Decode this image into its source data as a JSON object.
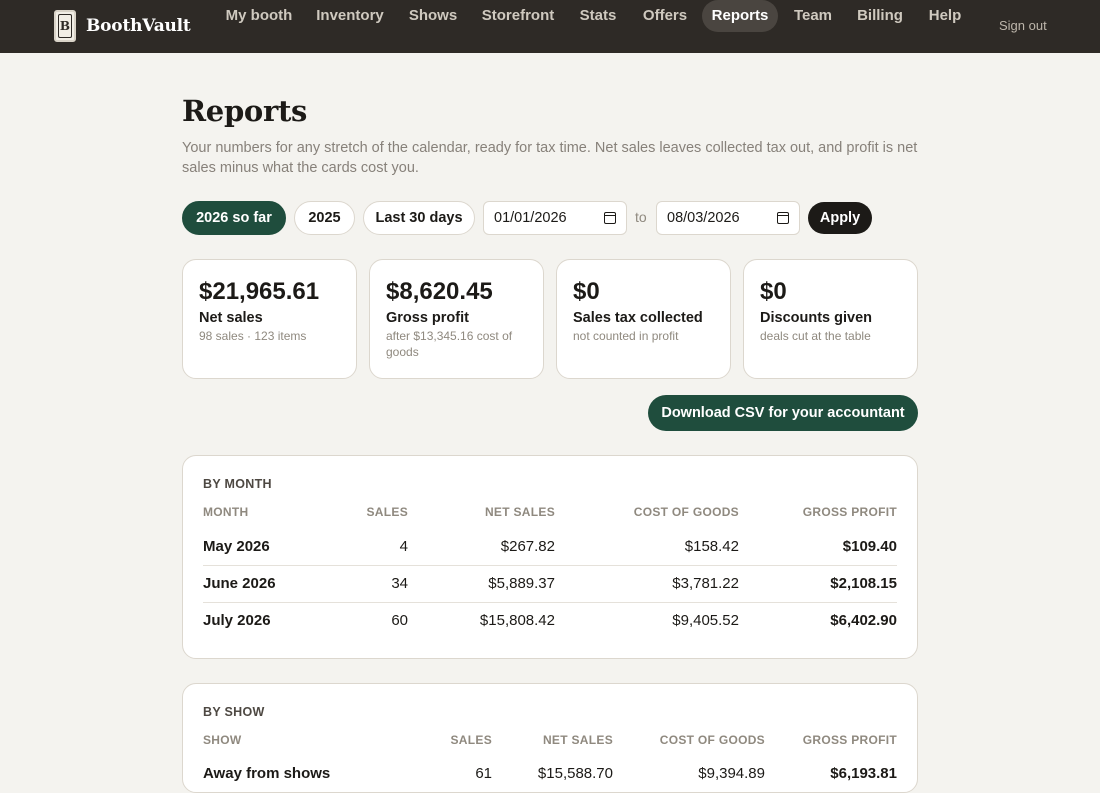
{
  "app": {
    "name": "BoothVault",
    "logo_letter": "B"
  },
  "nav": {
    "items": [
      {
        "label": "My booth",
        "active": false
      },
      {
        "label": "Inventory",
        "active": false
      },
      {
        "label": "Shows",
        "active": false
      },
      {
        "label": "Storefront",
        "active": false
      },
      {
        "label": "Stats",
        "active": false
      },
      {
        "label": "Offers",
        "active": false
      },
      {
        "label": "Reports",
        "active": true
      },
      {
        "label": "Team",
        "active": false
      },
      {
        "label": "Billing",
        "active": false
      },
      {
        "label": "Help",
        "active": false
      }
    ],
    "sign_out": "Sign out"
  },
  "header": {
    "title": "Reports",
    "description": "Your numbers for any stretch of the calendar, ready for tax time. Net sales leaves collected tax out, and profit is net sales minus what the cards cost you."
  },
  "range": {
    "presets": [
      {
        "label": "2026 so far",
        "active": true
      },
      {
        "label": "2025",
        "active": false
      },
      {
        "label": "Last 30 days",
        "active": false
      }
    ],
    "from": "01/01/2026",
    "to_label": "to",
    "to": "08/03/2026",
    "apply_label": "Apply"
  },
  "stats": [
    {
      "value": "$21,965.61",
      "label": "Net sales",
      "sub": "98 sales · 123 items"
    },
    {
      "value": "$8,620.45",
      "label": "Gross profit",
      "sub": "after $13,345.16 cost of goods"
    },
    {
      "value": "$0",
      "label": "Sales tax collected",
      "sub": "not counted in profit"
    },
    {
      "value": "$0",
      "label": "Discounts given",
      "sub": "deals cut at the table"
    }
  ],
  "csv_button": "Download CSV for your accountant",
  "by_month": {
    "title": "BY MONTH",
    "columns": [
      "MONTH",
      "SALES",
      "NET SALES",
      "COST OF GOODS",
      "GROSS PROFIT"
    ],
    "rows": [
      {
        "name": "May 2026",
        "sales": "4",
        "net": "$267.82",
        "cost": "$158.42",
        "profit": "$109.40"
      },
      {
        "name": "June 2026",
        "sales": "34",
        "net": "$5,889.37",
        "cost": "$3,781.22",
        "profit": "$2,108.15"
      },
      {
        "name": "July 2026",
        "sales": "60",
        "net": "$15,808.42",
        "cost": "$9,405.52",
        "profit": "$6,402.90"
      }
    ]
  },
  "by_show": {
    "title": "BY SHOW",
    "columns": [
      "SHOW",
      "SALES",
      "NET SALES",
      "COST OF GOODS",
      "GROSS PROFIT"
    ],
    "rows": [
      {
        "name": "Away from shows",
        "sales": "61",
        "net": "$15,588.70",
        "cost": "$9,394.89",
        "profit": "$6,193.81"
      }
    ]
  }
}
